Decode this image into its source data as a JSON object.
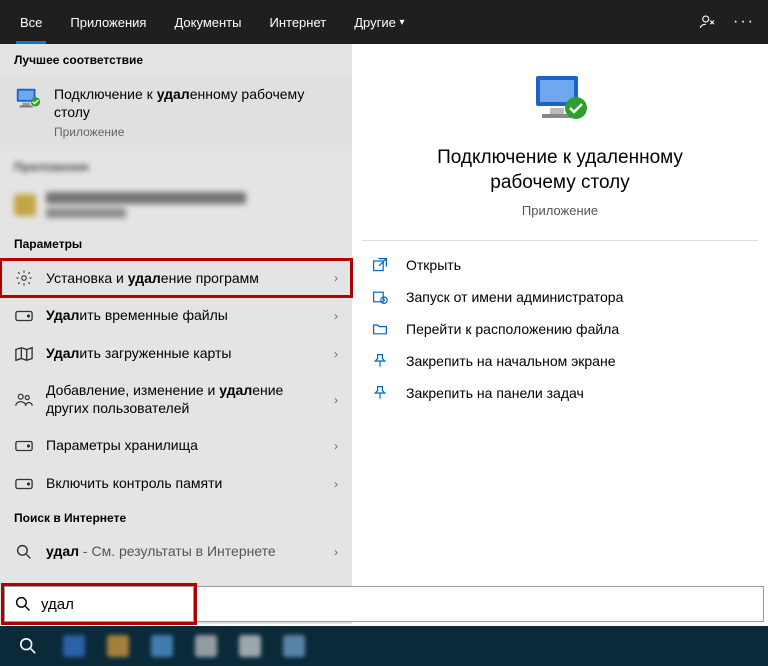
{
  "tabs": {
    "all": "Все",
    "apps": "Приложения",
    "docs": "Документы",
    "internet": "Интернет",
    "other": "Другие"
  },
  "sections": {
    "best_match": "Лучшее соответствие",
    "apps_blurred": "Приложения",
    "settings": "Параметры",
    "web_search": "Поиск в Интернете"
  },
  "best_match": {
    "title_pre": "Подключение к ",
    "title_bold": "удал",
    "title_post": "енному рабочему столу",
    "subtitle": "Приложение"
  },
  "settings": [
    {
      "icon": "gear",
      "pre": "Установка и ",
      "bold": "удал",
      "post": "ение программ"
    },
    {
      "icon": "storage",
      "pre": "",
      "bold": "Удал",
      "post": "ить временные файлы"
    },
    {
      "icon": "map",
      "pre": "",
      "bold": "Удал",
      "post": "ить загруженные карты"
    },
    {
      "icon": "people",
      "pre": "Добавление, изменение и ",
      "bold": "удал",
      "post": "ение других пользователей"
    },
    {
      "icon": "storage",
      "pre": "Параметры хранилища",
      "bold": "",
      "post": ""
    },
    {
      "icon": "storage",
      "pre": "Включить контроль памяти",
      "bold": "",
      "post": ""
    }
  ],
  "web_search": {
    "pre": "",
    "bold": "удал",
    "post": " - См. результаты в Интернете"
  },
  "detail": {
    "title": "Подключение к удаленному рабочему столу",
    "subtitle": "Приложение",
    "actions": {
      "open": "Открыть",
      "run_admin": "Запуск от имени администратора",
      "file_location": "Перейти к расположению файла",
      "pin_start": "Закрепить на начальном экране",
      "pin_taskbar": "Закрепить на панели задач"
    }
  },
  "search": {
    "value": "удал"
  }
}
